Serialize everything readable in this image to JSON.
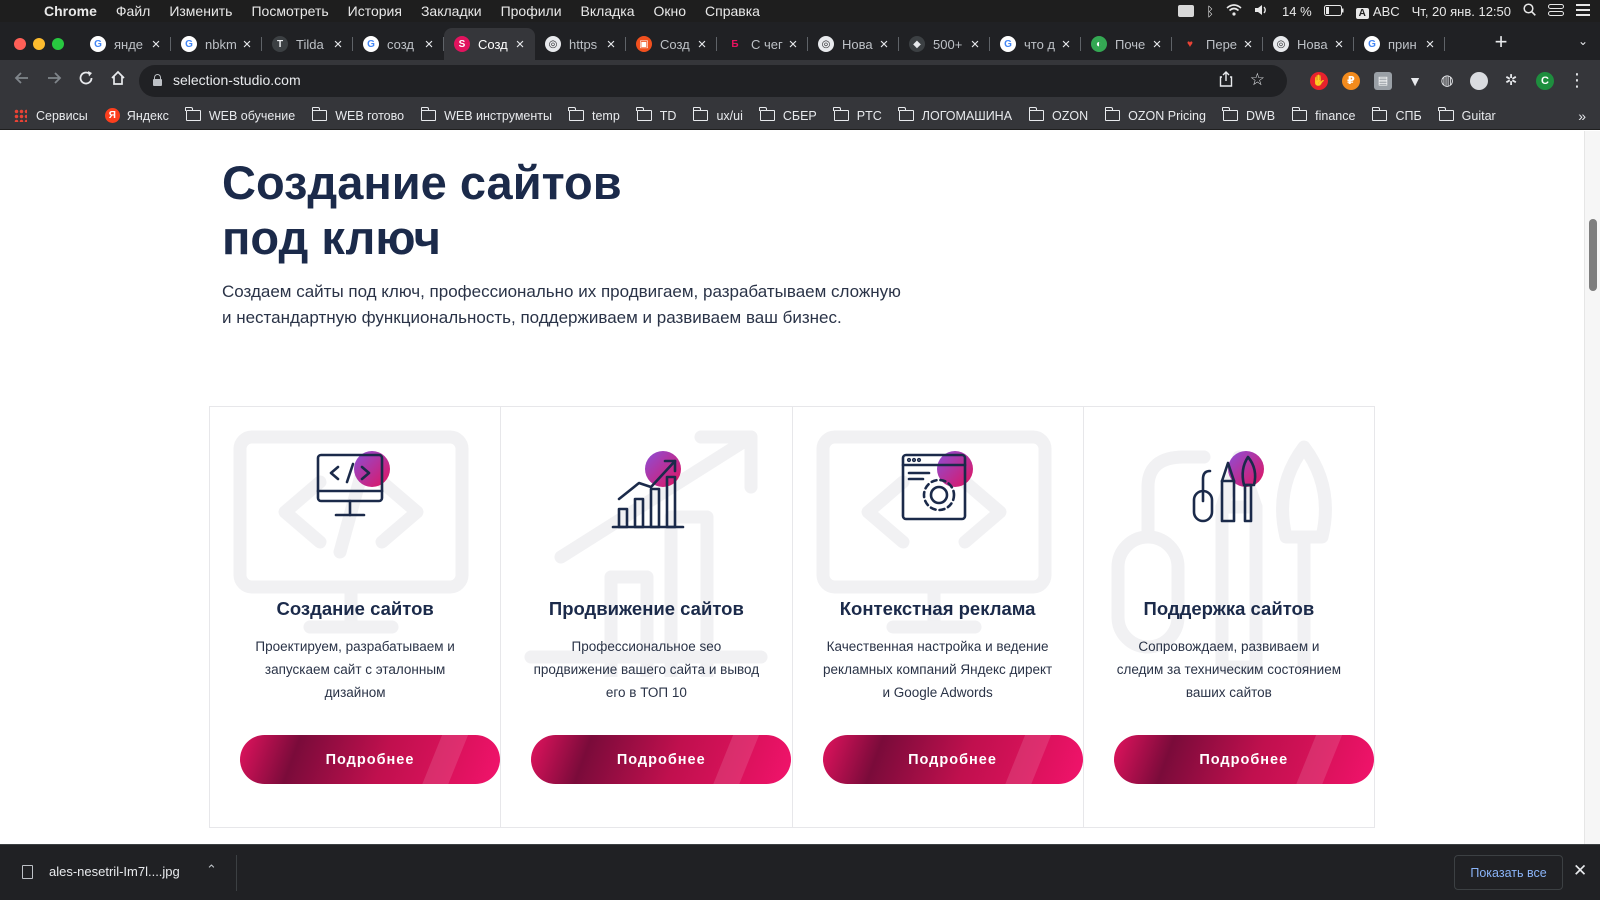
{
  "menubar": {
    "app_name": "Chrome",
    "items": [
      "Файл",
      "Изменить",
      "Посмотреть",
      "История",
      "Закладки",
      "Профили",
      "Вкладка",
      "Окно",
      "Справка"
    ],
    "battery": "14 %",
    "input_source": "ABC",
    "datetime": "Чт, 20 янв. 12:50"
  },
  "tabs": [
    {
      "title": "янде",
      "favicon": "google"
    },
    {
      "title": "nbkm",
      "favicon": "google"
    },
    {
      "title": "Tilda",
      "favicon": "tilda"
    },
    {
      "title": "созд",
      "favicon": "google"
    },
    {
      "title": "Созд",
      "favicon": "selection-studio",
      "active": true
    },
    {
      "title": "https",
      "favicon": "chrome"
    },
    {
      "title": "Созд",
      "favicon": "cube"
    },
    {
      "title": "С чег",
      "favicon": "b-logo"
    },
    {
      "title": "Нова",
      "favicon": "chrome"
    },
    {
      "title": "500+",
      "favicon": "dark"
    },
    {
      "title": "что д",
      "favicon": "google"
    },
    {
      "title": "Поче",
      "favicon": "green"
    },
    {
      "title": "Пере",
      "favicon": "heart"
    },
    {
      "title": "Нова",
      "favicon": "chrome"
    },
    {
      "title": "прин",
      "favicon": "google"
    }
  ],
  "toolbar": {
    "url": "selection-studio.com",
    "profile_initial": "C"
  },
  "bookmarks": [
    {
      "label": "Сервисы",
      "icon": "apps-icon"
    },
    {
      "label": "Яндекс",
      "icon": "yandex-icon"
    },
    {
      "label": "WEB обучение",
      "icon": "folder-icon"
    },
    {
      "label": "WEB готово",
      "icon": "folder-icon"
    },
    {
      "label": "WEB инструменты",
      "icon": "folder-icon"
    },
    {
      "label": "temp",
      "icon": "folder-icon"
    },
    {
      "label": "TD",
      "icon": "folder-icon"
    },
    {
      "label": "ux/ui",
      "icon": "folder-icon"
    },
    {
      "label": "СБЕР",
      "icon": "folder-icon"
    },
    {
      "label": "PTC",
      "icon": "folder-icon"
    },
    {
      "label": "ЛОГОМАШИНА",
      "icon": "folder-icon"
    },
    {
      "label": "OZON",
      "icon": "folder-icon"
    },
    {
      "label": "OZON Pricing",
      "icon": "folder-icon"
    },
    {
      "label": "DWB",
      "icon": "folder-icon"
    },
    {
      "label": "finance",
      "icon": "folder-icon"
    },
    {
      "label": "СПБ",
      "icon": "folder-icon"
    },
    {
      "label": "Guitar",
      "icon": "folder-icon"
    }
  ],
  "hero": {
    "title_line1": "Создание сайтов",
    "title_line2": "под ключ",
    "description": "Создаем сайты под ключ, профессионально их продвигаем, разрабатываем сложную и нестандартную функциональность, поддерживаем и развиваем ваш бизнес."
  },
  "cards": [
    {
      "title": "Создание сайтов",
      "text": "Проектируем, разрабатываем и запускаем сайт с эталонным дизайном",
      "button": "Подробнее",
      "icon": "monitor-code-icon"
    },
    {
      "title": "Продвижение сайтов",
      "text": "Профессиональное seo продвижение вашего сайта и вывод его в ТОП 10",
      "button": "Подробнее",
      "icon": "growth-chart-icon"
    },
    {
      "title": "Контекстная реклама",
      "text": "Качественная настройка и ведение рекламных компаний Яндекс директ и Google Adwords",
      "button": "Подробнее",
      "icon": "browser-gear-icon"
    },
    {
      "title": "Поддержка сайтов",
      "text": "Сопровождаем, развиваем и следим за техническим состоянием ваших сайтов",
      "button": "Подробнее",
      "icon": "tools-icon"
    }
  ],
  "download": {
    "file_name": "ales-nesetril-Im7l....jpg",
    "show_all": "Показать все"
  },
  "colors": {
    "heading": "#1b2a4a",
    "accent_pink": "#e2135e",
    "accent_purple": "#8b4fd8",
    "chrome_dark": "#202124",
    "chrome_toolbar": "#35363a"
  }
}
